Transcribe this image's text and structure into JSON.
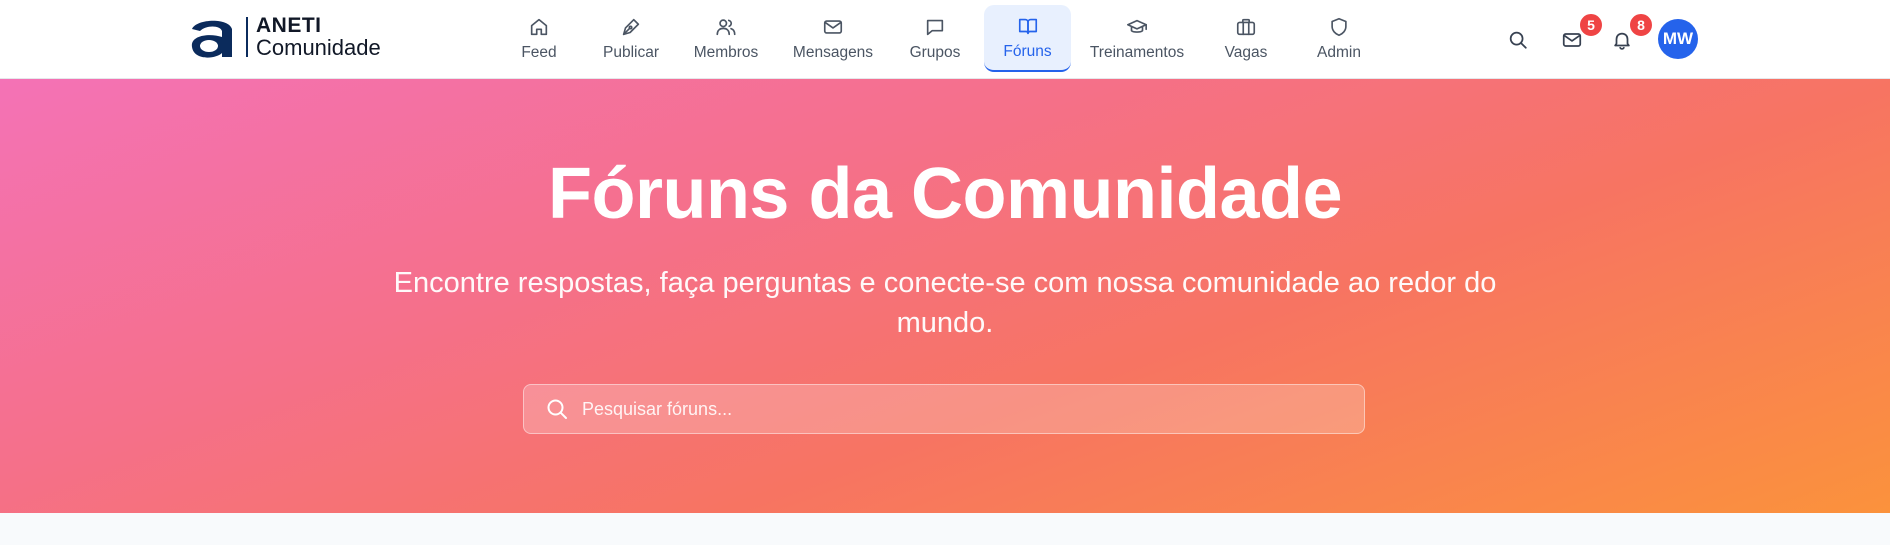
{
  "brand": {
    "name_line1": "ANETI",
    "name_line2": "Comunidade",
    "mark_letter": "a",
    "color": "#0b2b5c"
  },
  "nav": {
    "items": [
      {
        "label": "Feed",
        "icon": "home-icon",
        "active": false
      },
      {
        "label": "Publicar",
        "icon": "pen-icon",
        "active": false
      },
      {
        "label": "Membros",
        "icon": "users-icon",
        "active": false
      },
      {
        "label": "Mensagens",
        "icon": "mail-icon",
        "active": false
      },
      {
        "label": "Grupos",
        "icon": "chat-bubble-icon",
        "active": false
      },
      {
        "label": "Fóruns",
        "icon": "book-open-icon",
        "active": true
      },
      {
        "label": "Treinamentos",
        "icon": "graduation-cap-icon",
        "active": false
      },
      {
        "label": "Vagas",
        "icon": "briefcase-icon",
        "active": false
      },
      {
        "label": "Admin",
        "icon": "shield-icon",
        "active": false
      }
    ],
    "active_color": "#2563eb"
  },
  "toolbar": {
    "search_icon": "search-icon",
    "messages_badge": "5",
    "notifications_badge": "8",
    "badge_color": "#ef4444",
    "avatar_initials": "MW",
    "avatar_color": "#2563eb"
  },
  "hero": {
    "title": "Fóruns da Comunidade",
    "subtitle": "Encontre respostas, faça perguntas e conecte-se com nossa comunidade ao redor do mundo.",
    "search_placeholder": "Pesquisar fóruns...",
    "gradient_colors": [
      "#f472b6",
      "#f77462",
      "#fb923c"
    ]
  }
}
